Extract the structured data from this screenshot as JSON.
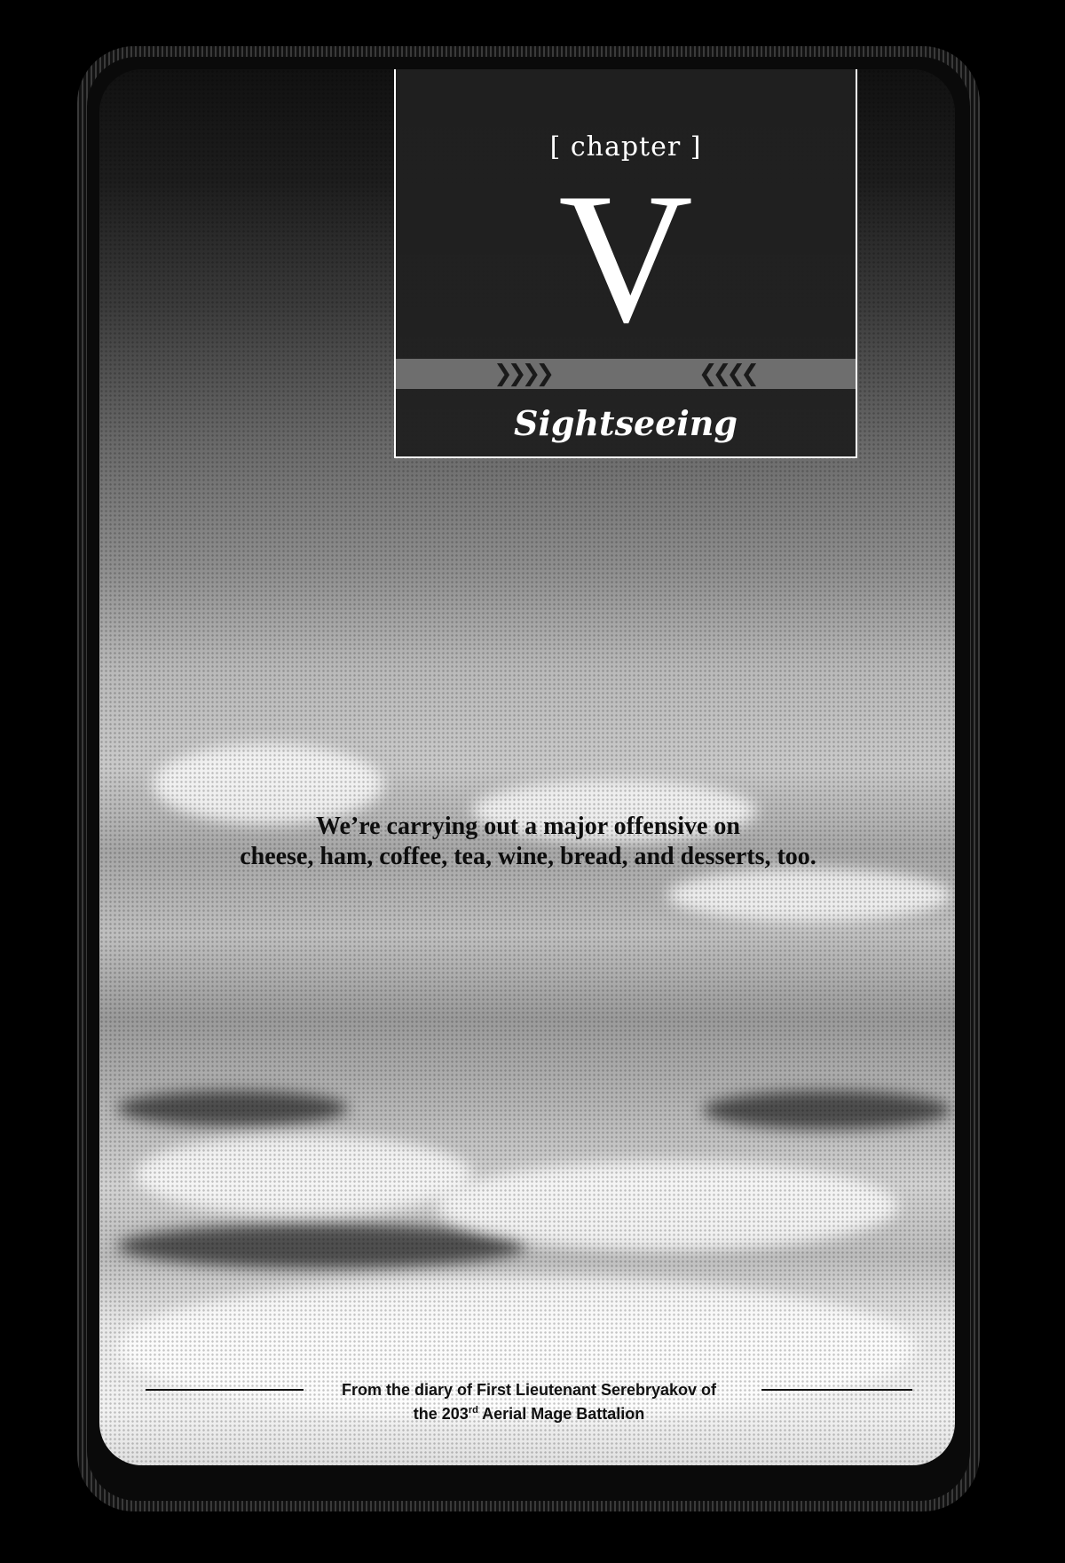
{
  "chapter": {
    "label": "[ chapter ]",
    "numeral": "V",
    "title": "Sightseeing"
  },
  "quote": {
    "line1": "We’re carrying out a major offensive on",
    "line2": "cheese, ham, coffee, tea, wine, bread, and desserts, too."
  },
  "attribution": {
    "line1": "From the diary of First Lieutenant Serebryakov of",
    "line2_prefix": "the 203",
    "line2_sup": "rd",
    "line2_suffix": " Aerial Mage Battalion"
  },
  "colors": {
    "frame": "#000000",
    "box": "#202020",
    "text_light": "#ffffff",
    "text_dark": "#111111"
  }
}
